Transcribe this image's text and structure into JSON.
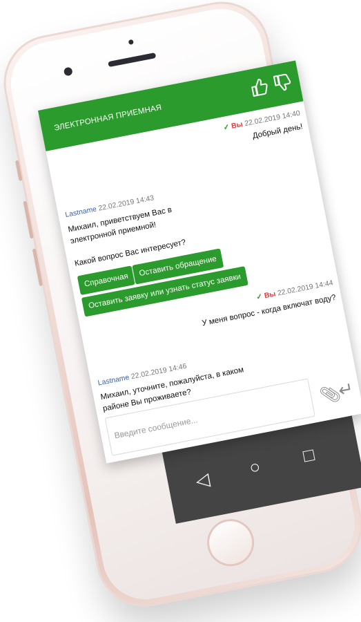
{
  "chat": {
    "title": "ЭЛЕКТРОННАЯ ПРИЕМНАЯ",
    "messages": [
      {
        "you_label": "Вы",
        "time": "22.02.2019 14:40",
        "text": "Добрый день!"
      },
      {
        "author": "Lastname",
        "time": "22.02.2019 14:43",
        "line1": "Михаил, приветствуем Вас в",
        "line2": "электронной приемной!",
        "line3": "Какой вопрос Вас интересует?"
      },
      {
        "you_label": "Вы",
        "time": "22.02.2019 14:44",
        "text": "У меня вопрос - когда включат воду?"
      },
      {
        "author": "Lastname",
        "time": "22.02.2019 14:46",
        "line1": "Михаил, уточните, пожалуйста, в каком",
        "line2": "районе Вы проживаете?"
      }
    ],
    "buttons": {
      "reference": "Справочная",
      "appeal": "Оставить обращение",
      "request": "Оставить заявку или узнать статус заявки"
    },
    "input_placeholder": "Введите сообщение...",
    "icons": {
      "like": "thumbs-up-icon",
      "dislike": "thumbs-down-icon",
      "attach": "paperclip-icon",
      "send": "enter-arrow-icon"
    },
    "colors": {
      "accent": "#2a9b2c",
      "author": "#3b65a0",
      "you": "#e23b3b"
    }
  }
}
